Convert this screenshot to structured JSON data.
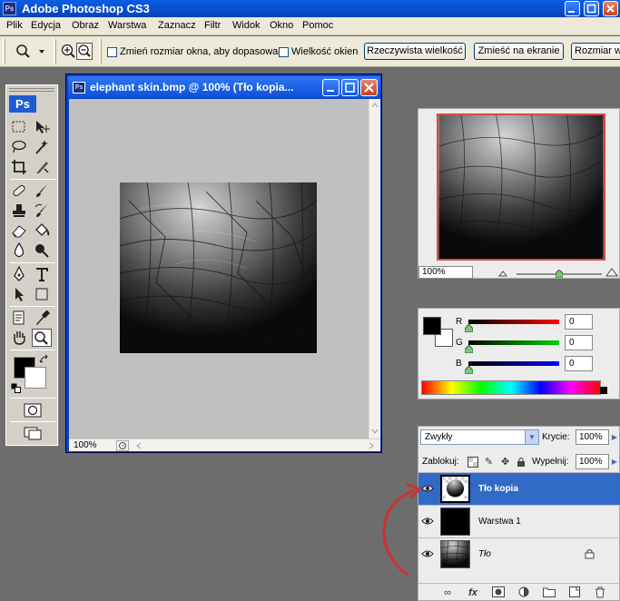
{
  "window": {
    "title": "Adobe Photoshop CS3",
    "app_icon": "Ps"
  },
  "menu": [
    "Plik",
    "Edycja",
    "Obraz",
    "Warstwa",
    "Zaznacz",
    "Filtr",
    "Widok",
    "Okno",
    "Pomoc"
  ],
  "options_bar": {
    "resize_windows_label": "Zmień rozmiar okna, aby dopasować",
    "window_size_label": "Wielkość okien",
    "actual_pixels_button": "Rzeczywista wielkość",
    "fit_screen_button": "Zmieść na ekranie",
    "print_size_button": "Rozmiar w"
  },
  "toolbox": {
    "logo": "Ps"
  },
  "document": {
    "title": "elephant skin.bmp @ 100% (Tło kopia...",
    "icon_label": "Ps",
    "zoom": "100%"
  },
  "navigator": {
    "zoom": "100%",
    "zoom_slider_fraction": 0.5
  },
  "color": {
    "channels": [
      {
        "label": "R",
        "value": "0"
      },
      {
        "label": "G",
        "value": "0"
      },
      {
        "label": "B",
        "value": "0"
      }
    ],
    "foreground": "#000000",
    "background": "#ffffff"
  },
  "layers": {
    "blend_mode": "Zwykły",
    "opacity_label": "Krycie:",
    "opacity": "100%",
    "lock_label": "Zablokuj:",
    "fill_label": "Wypełnij:",
    "fill": "100%",
    "items": [
      {
        "name": "Tło kopia",
        "selected": true,
        "visible": true,
        "locked": false
      },
      {
        "name": "Warstwa 1",
        "selected": false,
        "visible": true,
        "locked": false
      },
      {
        "name": "Tło",
        "selected": false,
        "visible": true,
        "locked": true
      }
    ]
  },
  "colors": {
    "titlebar": "#0843b8",
    "selection": "#3169c6",
    "workspace": "#6d6d6d",
    "annotation_arrow": "#d12f2f"
  }
}
